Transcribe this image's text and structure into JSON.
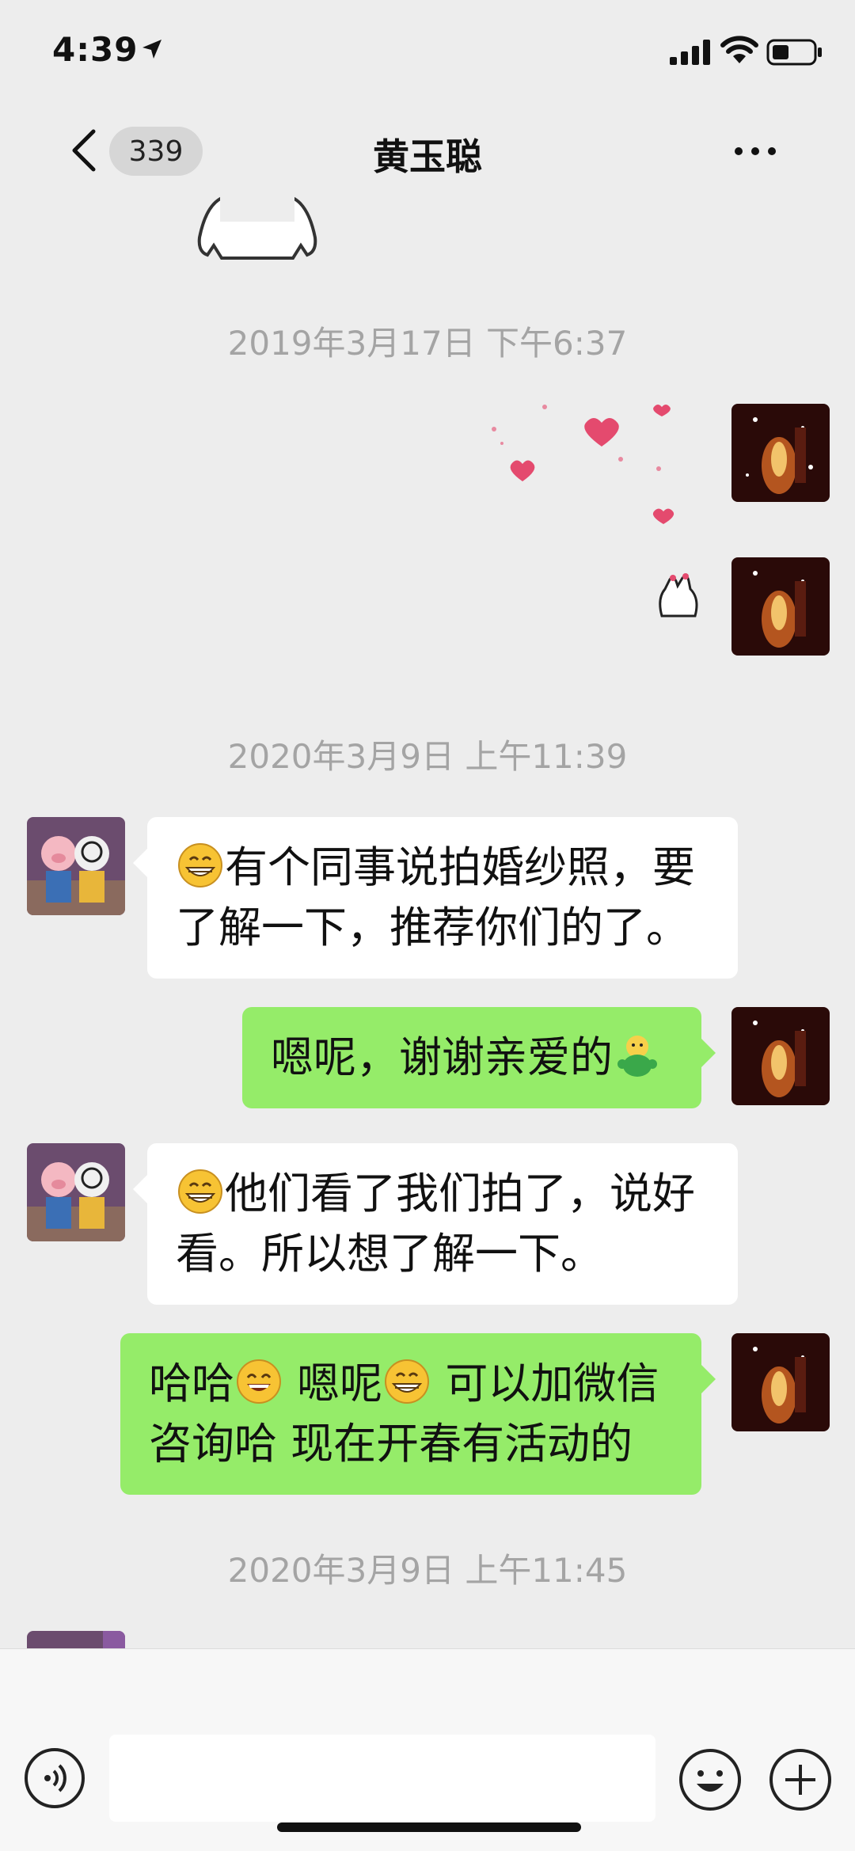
{
  "status_bar": {
    "time": "4:39"
  },
  "nav": {
    "unread_count": "339",
    "title": "黄玉聪"
  },
  "timestamps": [
    "2019年3月17日 下午6:37",
    "2020年3月9日 上午11:39",
    "2020年3月9日 上午11:45"
  ],
  "messages": [
    {
      "sender": "contact",
      "lines": [
        "有个同事说拍婚纱照，要",
        "了解一下，推荐你们的了。"
      ],
      "leading_emoji": "grin-emoji"
    },
    {
      "sender": "me",
      "lines": [
        "嗯呢，谢谢亲爱的"
      ],
      "trailing_emoji": "green-figure-emoji"
    },
    {
      "sender": "contact",
      "lines": [
        "他们看了我们拍了，说好",
        "看。所以想了解一下。"
      ],
      "leading_emoji": "grin-emoji"
    },
    {
      "sender": "me",
      "lines": [
        "哈哈",
        "嗯呢",
        "可以加微信",
        "咨询哈 现在开春有活动的"
      ]
    }
  ],
  "input": {
    "placeholder": ""
  },
  "colors": {
    "background": "#ededed",
    "outgoing_bubble": "#95ec69",
    "incoming_bubble": "#ffffff",
    "timestamp": "#a4a4a4"
  }
}
